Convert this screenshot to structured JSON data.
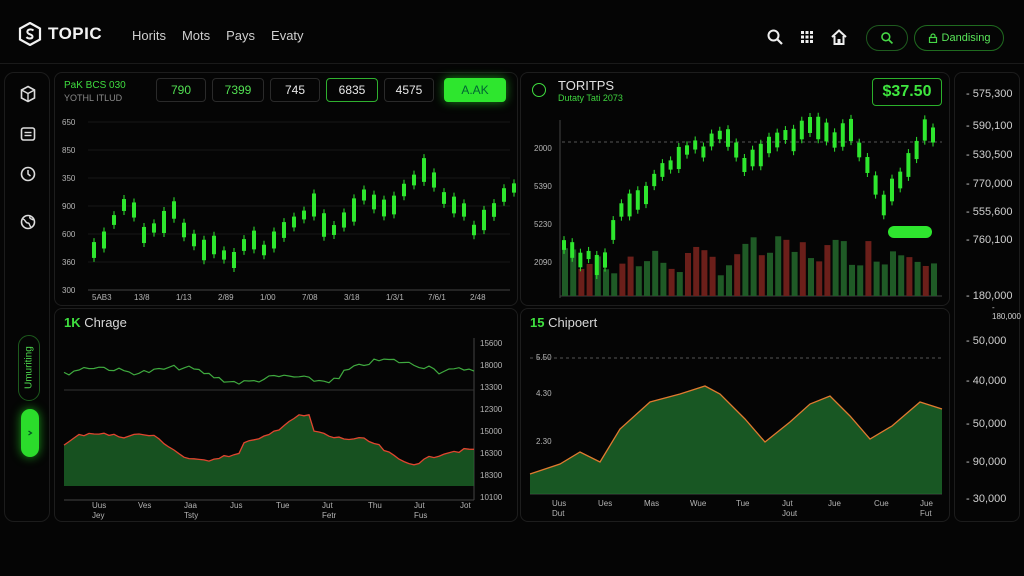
{
  "app": {
    "logo_text": "TOPIC",
    "nav": [
      "Horits",
      "Mots",
      "Pays",
      "Evaty"
    ],
    "pill_label": "Dandising"
  },
  "sidebar": {
    "label": "Umuriting"
  },
  "panel_tl": {
    "ticker": "PaK BCS 030",
    "ticker_sub": "YOTHL ITLUD",
    "tabs": [
      "790",
      "7399",
      "745",
      "6835",
      "4575",
      "A.AK"
    ],
    "y_ticks": [
      "650",
      "850",
      "350",
      "900",
      "600",
      "360",
      "300"
    ],
    "x_ticks": [
      "5AB3",
      "13/8",
      "1/13",
      "2/89",
      "1/00",
      "7/08",
      "3/18",
      "1/3/1",
      "7/6/1",
      "2/48"
    ]
  },
  "panel_tr": {
    "name": "TORITPS",
    "sub": "Dutaty Tati 2073",
    "price": "$37.50",
    "y_ticks": [
      "2000",
      "5390",
      "5230",
      "2090"
    ]
  },
  "panel_bl": {
    "title_num": "1K",
    "title": "Chrage",
    "right_ticks": [
      "15600",
      "18000",
      "13300",
      "12300",
      "15000",
      "16300",
      "18300",
      "10100"
    ],
    "x_ticks": [
      "Uus",
      "Ves",
      "Jaa",
      "Jus",
      "Tue",
      "Jut",
      "Thu",
      "Jut",
      "Jot"
    ],
    "x_sub": [
      "Jey",
      "",
      "Tsty",
      "",
      "",
      "Fetr",
      "",
      "Fus",
      ""
    ]
  },
  "panel_br": {
    "title_num": "15",
    "title": "Chipoert",
    "y_ticks": [
      "5.50",
      "4.30",
      "2.30"
    ],
    "x_ticks": [
      "Uus",
      "Ues",
      "Mas",
      "Wue",
      "Tue",
      "Jut",
      "Jue",
      "Cue",
      "Jue"
    ],
    "x_sub": [
      "Dut",
      "",
      "",
      "",
      "",
      "Jout",
      "",
      "",
      "Fut"
    ]
  },
  "right_axis": [
    "575,300",
    "590,100",
    "530,500",
    "770,000",
    "555,600",
    "760,100",
    "180,000",
    "180,000",
    "50,000",
    "40,000",
    "50,000",
    "90,000",
    "30,000"
  ],
  "colors": {
    "accent": "#2ee62e",
    "bear": "#c0392b",
    "area": "#1d6b2a",
    "bg": "#050505"
  }
}
